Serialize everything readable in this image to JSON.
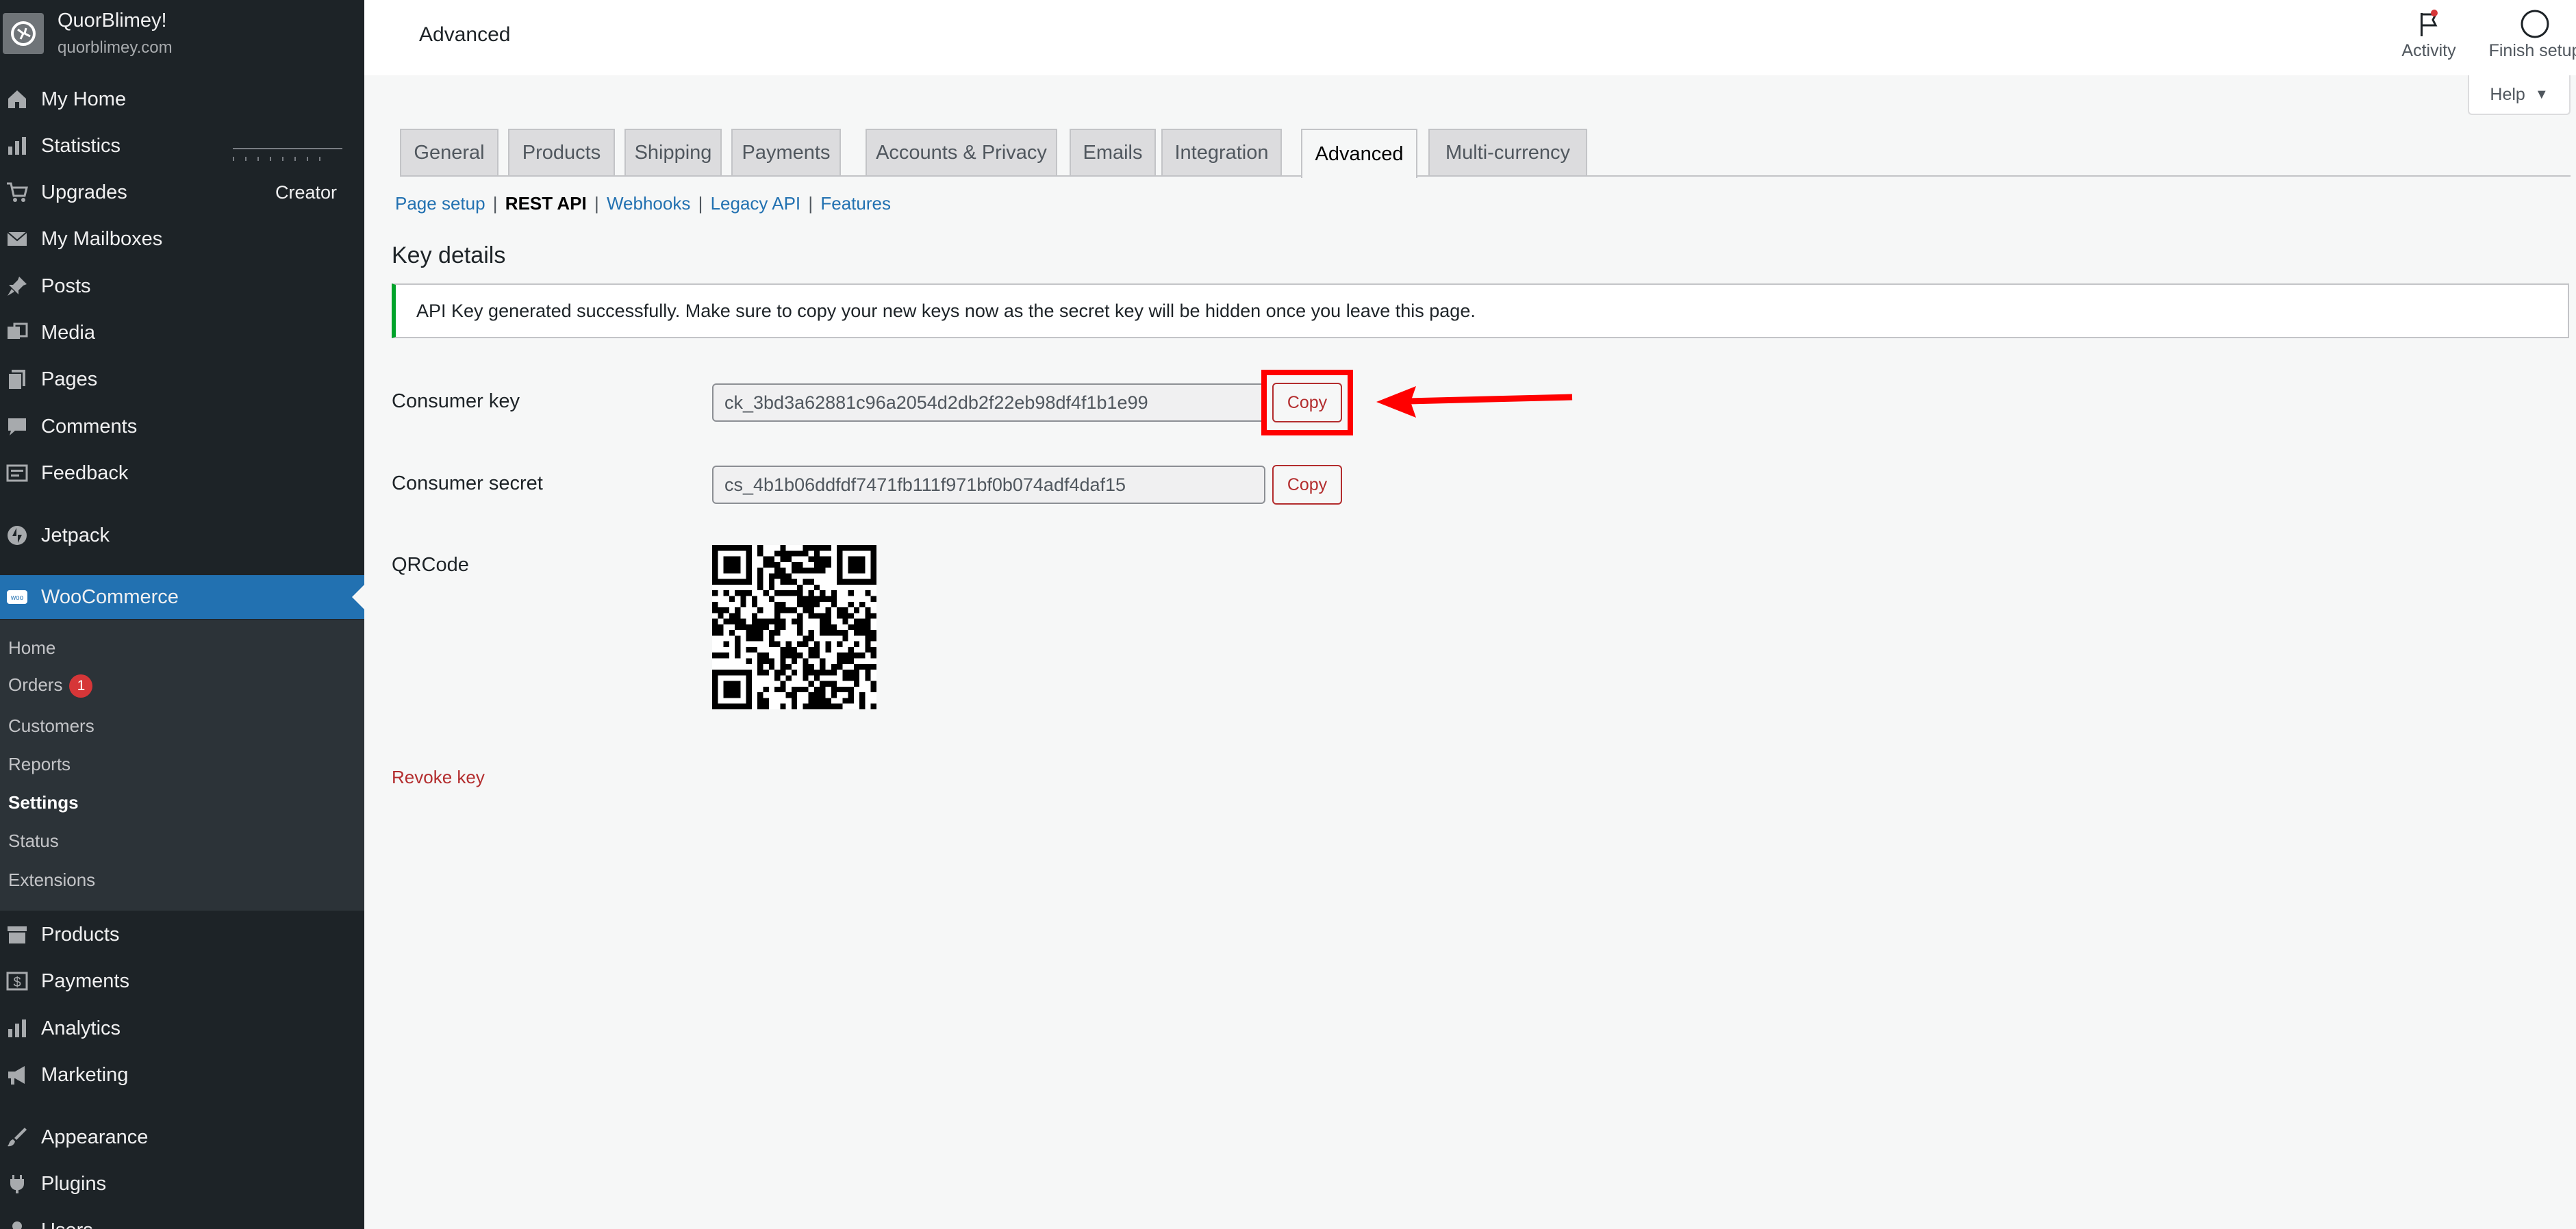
{
  "site": {
    "name": "QuorBlimey!",
    "url": "quorblimey.com"
  },
  "menu": {
    "my_home": "My Home",
    "statistics": "Statistics",
    "upgrades": "Upgrades",
    "upgrades_plan": "Creator",
    "my_mailboxes": "My Mailboxes",
    "posts": "Posts",
    "media": "Media",
    "pages": "Pages",
    "comments": "Comments",
    "feedback": "Feedback",
    "jetpack": "Jetpack",
    "woocommerce": "WooCommerce",
    "products": "Products",
    "payments": "Payments",
    "analytics": "Analytics",
    "marketing": "Marketing",
    "appearance": "Appearance",
    "plugins": "Plugins",
    "users": "Users"
  },
  "submenu": {
    "home": "Home",
    "orders": "Orders",
    "orders_badge": "1",
    "customers": "Customers",
    "reports": "Reports",
    "settings": "Settings",
    "status": "Status",
    "extensions": "Extensions"
  },
  "topbar": {
    "title": "Advanced",
    "activity": "Activity",
    "finish_setup": "Finish setup",
    "help": "Help"
  },
  "tabs": [
    "General",
    "Products",
    "Shipping",
    "Payments",
    "Accounts & Privacy",
    "Emails",
    "Integration",
    "Advanced",
    "Multi-currency"
  ],
  "subsub": {
    "page_setup": "Page setup",
    "rest_api": "REST API",
    "webhooks": "Webhooks",
    "legacy_api": "Legacy API",
    "features": "Features",
    "sep": "|"
  },
  "key_details": {
    "heading": "Key details",
    "notice": "API Key generated successfully. Make sure to copy your new keys now as the secret key will be hidden once you leave this page.",
    "consumer_key_label": "Consumer key",
    "consumer_key_value": "ck_3bd3a62881c96a2054d2db2f22eb98df4f1b1e99",
    "consumer_secret_label": "Consumer secret",
    "consumer_secret_value": "cs_4b1b06ddfdf7471fb111f971bf0b074adf4daf15",
    "copy_label": "Copy",
    "qrcode_label": "QRCode",
    "revoke_label": "Revoke key"
  },
  "colors": {
    "sidebar_bg": "#1d2327",
    "active_menu": "#2271b1",
    "danger": "#b32d2e",
    "annotation": "#ff0000",
    "success": "#00a32a"
  }
}
